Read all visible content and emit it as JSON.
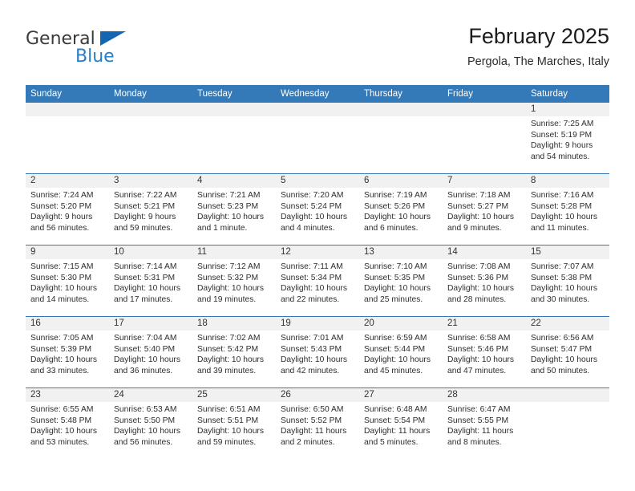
{
  "brand": {
    "name_part1": "General",
    "name_part2": "Blue",
    "accent_color": "#2a7fc9",
    "triangle_color": "#1566b0"
  },
  "header": {
    "title": "February 2025",
    "subtitle": "Pergola, The Marches, Italy"
  },
  "theme": {
    "header_bg": "#3479b8",
    "daynum_band_bg": "#f1f1f1",
    "cell_bg": "#ffffff"
  },
  "weekday_headers": [
    "Sunday",
    "Monday",
    "Tuesday",
    "Wednesday",
    "Thursday",
    "Friday",
    "Saturday"
  ],
  "weeks": [
    [
      {
        "empty": true
      },
      {
        "empty": true
      },
      {
        "empty": true
      },
      {
        "empty": true
      },
      {
        "empty": true
      },
      {
        "empty": true
      },
      {
        "day": "1",
        "sunrise": "Sunrise: 7:25 AM",
        "sunset": "Sunset: 5:19 PM",
        "daylight_line1": "Daylight: 9 hours",
        "daylight_line2": "and 54 minutes."
      }
    ],
    [
      {
        "day": "2",
        "sunrise": "Sunrise: 7:24 AM",
        "sunset": "Sunset: 5:20 PM",
        "daylight_line1": "Daylight: 9 hours",
        "daylight_line2": "and 56 minutes."
      },
      {
        "day": "3",
        "sunrise": "Sunrise: 7:22 AM",
        "sunset": "Sunset: 5:21 PM",
        "daylight_line1": "Daylight: 9 hours",
        "daylight_line2": "and 59 minutes."
      },
      {
        "day": "4",
        "sunrise": "Sunrise: 7:21 AM",
        "sunset": "Sunset: 5:23 PM",
        "daylight_line1": "Daylight: 10 hours",
        "daylight_line2": "and 1 minute."
      },
      {
        "day": "5",
        "sunrise": "Sunrise: 7:20 AM",
        "sunset": "Sunset: 5:24 PM",
        "daylight_line1": "Daylight: 10 hours",
        "daylight_line2": "and 4 minutes."
      },
      {
        "day": "6",
        "sunrise": "Sunrise: 7:19 AM",
        "sunset": "Sunset: 5:26 PM",
        "daylight_line1": "Daylight: 10 hours",
        "daylight_line2": "and 6 minutes."
      },
      {
        "day": "7",
        "sunrise": "Sunrise: 7:18 AM",
        "sunset": "Sunset: 5:27 PM",
        "daylight_line1": "Daylight: 10 hours",
        "daylight_line2": "and 9 minutes."
      },
      {
        "day": "8",
        "sunrise": "Sunrise: 7:16 AM",
        "sunset": "Sunset: 5:28 PM",
        "daylight_line1": "Daylight: 10 hours",
        "daylight_line2": "and 11 minutes."
      }
    ],
    [
      {
        "day": "9",
        "sunrise": "Sunrise: 7:15 AM",
        "sunset": "Sunset: 5:30 PM",
        "daylight_line1": "Daylight: 10 hours",
        "daylight_line2": "and 14 minutes."
      },
      {
        "day": "10",
        "sunrise": "Sunrise: 7:14 AM",
        "sunset": "Sunset: 5:31 PM",
        "daylight_line1": "Daylight: 10 hours",
        "daylight_line2": "and 17 minutes."
      },
      {
        "day": "11",
        "sunrise": "Sunrise: 7:12 AM",
        "sunset": "Sunset: 5:32 PM",
        "daylight_line1": "Daylight: 10 hours",
        "daylight_line2": "and 19 minutes."
      },
      {
        "day": "12",
        "sunrise": "Sunrise: 7:11 AM",
        "sunset": "Sunset: 5:34 PM",
        "daylight_line1": "Daylight: 10 hours",
        "daylight_line2": "and 22 minutes."
      },
      {
        "day": "13",
        "sunrise": "Sunrise: 7:10 AM",
        "sunset": "Sunset: 5:35 PM",
        "daylight_line1": "Daylight: 10 hours",
        "daylight_line2": "and 25 minutes."
      },
      {
        "day": "14",
        "sunrise": "Sunrise: 7:08 AM",
        "sunset": "Sunset: 5:36 PM",
        "daylight_line1": "Daylight: 10 hours",
        "daylight_line2": "and 28 minutes."
      },
      {
        "day": "15",
        "sunrise": "Sunrise: 7:07 AM",
        "sunset": "Sunset: 5:38 PM",
        "daylight_line1": "Daylight: 10 hours",
        "daylight_line2": "and 30 minutes."
      }
    ],
    [
      {
        "day": "16",
        "sunrise": "Sunrise: 7:05 AM",
        "sunset": "Sunset: 5:39 PM",
        "daylight_line1": "Daylight: 10 hours",
        "daylight_line2": "and 33 minutes."
      },
      {
        "day": "17",
        "sunrise": "Sunrise: 7:04 AM",
        "sunset": "Sunset: 5:40 PM",
        "daylight_line1": "Daylight: 10 hours",
        "daylight_line2": "and 36 minutes."
      },
      {
        "day": "18",
        "sunrise": "Sunrise: 7:02 AM",
        "sunset": "Sunset: 5:42 PM",
        "daylight_line1": "Daylight: 10 hours",
        "daylight_line2": "and 39 minutes."
      },
      {
        "day": "19",
        "sunrise": "Sunrise: 7:01 AM",
        "sunset": "Sunset: 5:43 PM",
        "daylight_line1": "Daylight: 10 hours",
        "daylight_line2": "and 42 minutes."
      },
      {
        "day": "20",
        "sunrise": "Sunrise: 6:59 AM",
        "sunset": "Sunset: 5:44 PM",
        "daylight_line1": "Daylight: 10 hours",
        "daylight_line2": "and 45 minutes."
      },
      {
        "day": "21",
        "sunrise": "Sunrise: 6:58 AM",
        "sunset": "Sunset: 5:46 PM",
        "daylight_line1": "Daylight: 10 hours",
        "daylight_line2": "and 47 minutes."
      },
      {
        "day": "22",
        "sunrise": "Sunrise: 6:56 AM",
        "sunset": "Sunset: 5:47 PM",
        "daylight_line1": "Daylight: 10 hours",
        "daylight_line2": "and 50 minutes."
      }
    ],
    [
      {
        "day": "23",
        "sunrise": "Sunrise: 6:55 AM",
        "sunset": "Sunset: 5:48 PM",
        "daylight_line1": "Daylight: 10 hours",
        "daylight_line2": "and 53 minutes."
      },
      {
        "day": "24",
        "sunrise": "Sunrise: 6:53 AM",
        "sunset": "Sunset: 5:50 PM",
        "daylight_line1": "Daylight: 10 hours",
        "daylight_line2": "and 56 minutes."
      },
      {
        "day": "25",
        "sunrise": "Sunrise: 6:51 AM",
        "sunset": "Sunset: 5:51 PM",
        "daylight_line1": "Daylight: 10 hours",
        "daylight_line2": "and 59 minutes."
      },
      {
        "day": "26",
        "sunrise": "Sunrise: 6:50 AM",
        "sunset": "Sunset: 5:52 PM",
        "daylight_line1": "Daylight: 11 hours",
        "daylight_line2": "and 2 minutes."
      },
      {
        "day": "27",
        "sunrise": "Sunrise: 6:48 AM",
        "sunset": "Sunset: 5:54 PM",
        "daylight_line1": "Daylight: 11 hours",
        "daylight_line2": "and 5 minutes."
      },
      {
        "day": "28",
        "sunrise": "Sunrise: 6:47 AM",
        "sunset": "Sunset: 5:55 PM",
        "daylight_line1": "Daylight: 11 hours",
        "daylight_line2": "and 8 minutes."
      },
      {
        "empty": true
      }
    ]
  ]
}
